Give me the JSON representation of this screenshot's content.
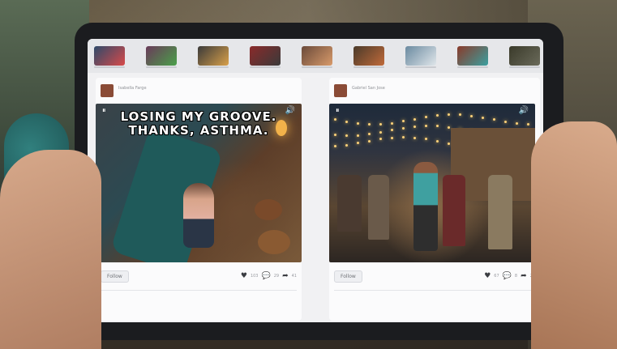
{
  "thumbnails": [
    {
      "color": "#2d4a6a",
      "accent": "#d84a4a"
    },
    {
      "color": "#6a3a5a",
      "accent": "#4aa04a"
    },
    {
      "color": "#3a3a3a",
      "accent": "#d8a04a"
    },
    {
      "color": "#8a2a2a",
      "accent": "#3a3a3a"
    },
    {
      "color": "#6a4a3a",
      "accent": "#d89a6a"
    },
    {
      "color": "#4a3a2a",
      "accent": "#c06a3a"
    },
    {
      "color": "#6a8aa0",
      "accent": "#e0e6ea"
    },
    {
      "color": "#8a3a2a",
      "accent": "#3aa0a0"
    },
    {
      "color": "#3a3a2a",
      "accent": "#6a6a5a"
    }
  ],
  "posts": [
    {
      "author": "Isabella Farge",
      "caption_line1": "LOSING MY GROOVE.",
      "caption_line2": "THANKS, ASTHMA.",
      "follow_label": "Follow",
      "likes": "103",
      "comments": "29",
      "shares": "41"
    },
    {
      "author": "Gabriel San Jose",
      "follow_label": "Follow",
      "likes": "67",
      "comments": "8",
      "shares": "29"
    }
  ],
  "icons": {
    "pause": "⏸",
    "volume": "🔊",
    "heart": "♥",
    "comment": "💬",
    "share": "➦"
  }
}
